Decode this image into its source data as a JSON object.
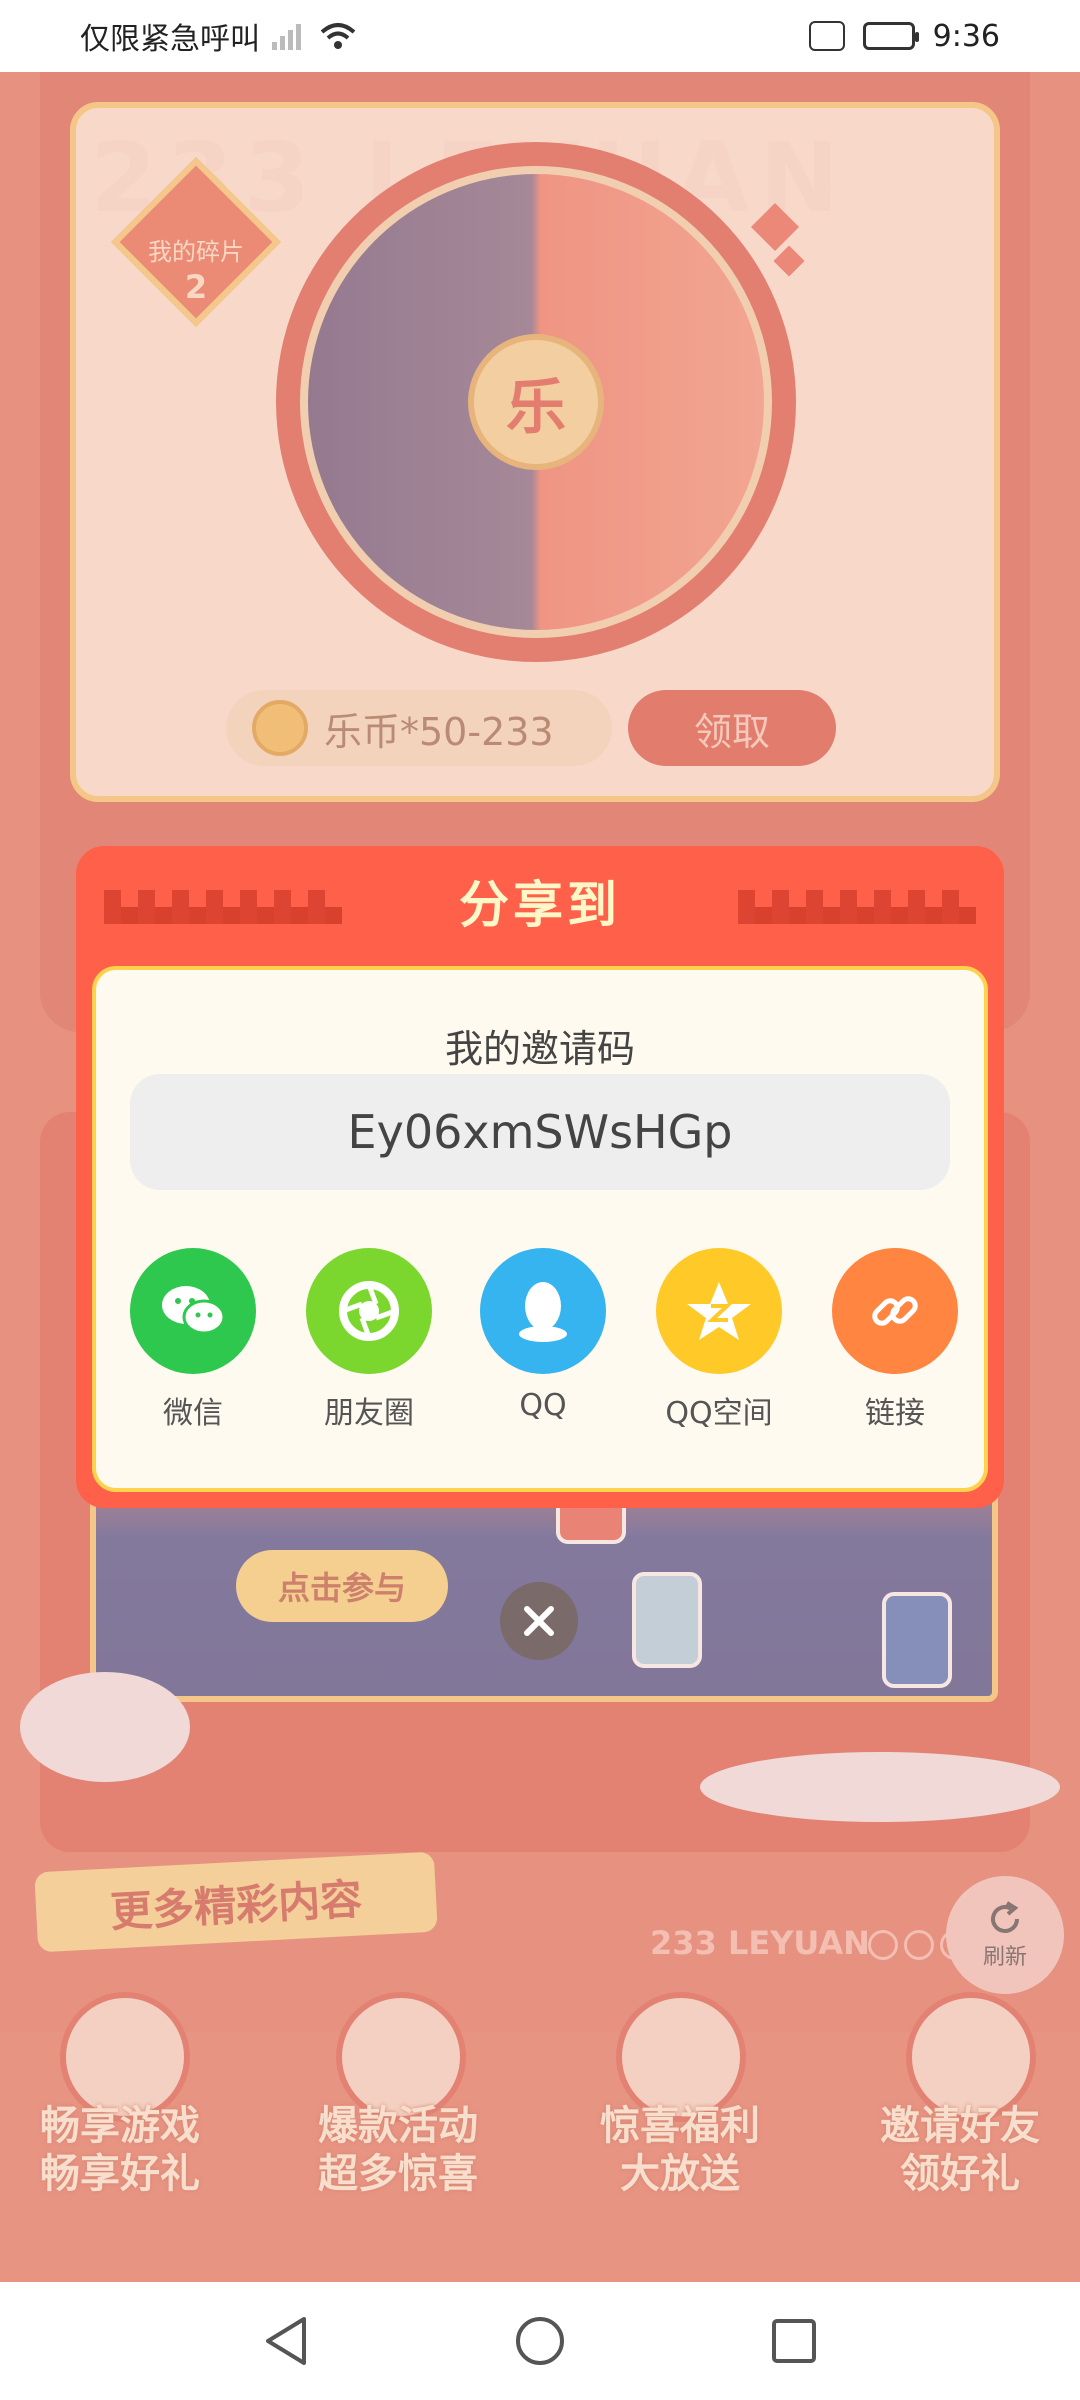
{
  "status_bar": {
    "carrier_text": "仅限紧急呼叫",
    "time": "9:36"
  },
  "background": {
    "watermark": "233 LEYUAN",
    "fragments_label": "我的碎片",
    "fragments_count": "2",
    "medal_char": "乐",
    "coin_reward": "乐币*50-233",
    "claim_button": "领取",
    "banner_button": "点击参与",
    "more_content": "更多精彩内容",
    "leyuan_label": "233 LEYUAN",
    "refresh_label": "刷新",
    "features": [
      {
        "line1": "畅享游戏",
        "line2": "畅享好礼"
      },
      {
        "line1": "爆款活动",
        "line2": "超多惊喜"
      },
      {
        "line1": "惊喜福利",
        "line2": "大放送"
      },
      {
        "line1": "邀请好友",
        "line2": "领好礼"
      }
    ]
  },
  "modal": {
    "title": "分享到",
    "invite_label": "我的邀请码",
    "invite_code": "Ey06xmSWsHGp",
    "share_targets": [
      {
        "label": "微信",
        "icon": "wechat-icon",
        "color": "#2dc84d"
      },
      {
        "label": "朋友圈",
        "icon": "moments-icon",
        "color": "#7bd72e"
      },
      {
        "label": "QQ",
        "icon": "qq-icon",
        "color": "#35b4f0"
      },
      {
        "label": "QQ空间",
        "icon": "qzone-icon",
        "color": "#ffc928"
      },
      {
        "label": "链接",
        "icon": "link-icon",
        "color": "#ff8540"
      }
    ]
  },
  "colors": {
    "modal_red": "#ff6049",
    "modal_title": "#fff7c8",
    "body_border": "#ffd24d"
  }
}
